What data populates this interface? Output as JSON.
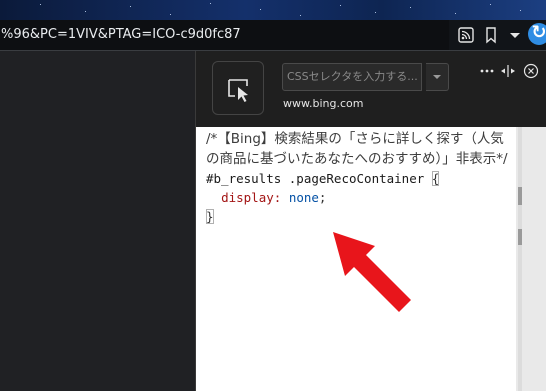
{
  "address_bar": {
    "url": "%96&PC=1VIV&PTAG=ICO-c9d0fc87",
    "icons": [
      "feed-icon",
      "bookmark-icon",
      "chevron-down-icon",
      "edge-profile-icon"
    ]
  },
  "devtools": {
    "selector_input": {
      "placeholder": "CSSセレクタを入力する...",
      "value": ""
    },
    "domain": "www.bing.com",
    "header_icons": [
      "more-dots-icon",
      "resize-icon",
      "close-icon"
    ],
    "code": {
      "comment": "/*【Bing】検索結果の「さらに詳しく探す（人気の商品に基づいたあなたへのおすすめ）」非表示*/",
      "selector": "#b_results .pageRecoContainer ",
      "open_brace": "{",
      "property": "display:",
      "value": "none",
      "semicolon": ";",
      "close_brace": "}"
    }
  },
  "colors": {
    "arrow": "#e8151b",
    "url_text": "#e9ecef",
    "css_property": "#a31515",
    "css_value": "#0451a5"
  }
}
